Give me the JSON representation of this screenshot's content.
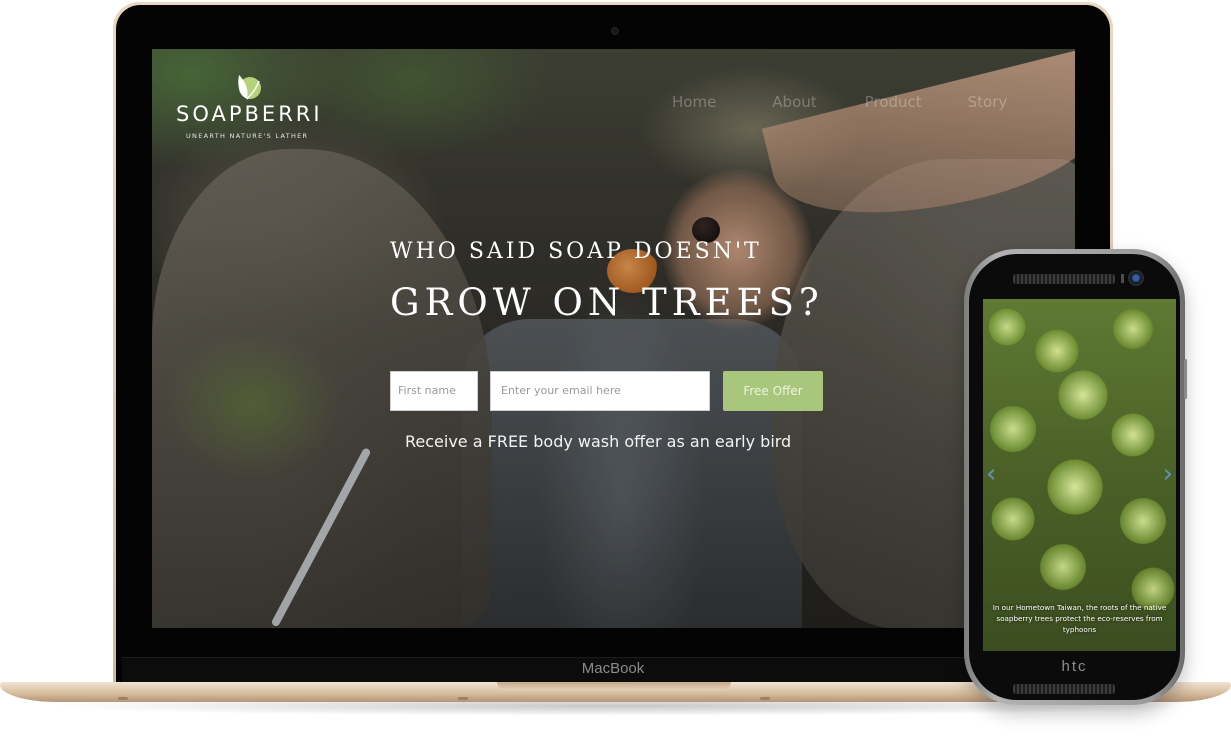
{
  "laptop": {
    "brand_label": "MacBook"
  },
  "site": {
    "logo": {
      "name": "SOAPBERRI",
      "tagline": "UNEARTH NATURE'S LATHER",
      "leaf_colors": [
        "#ffffff",
        "#b7d37a"
      ]
    },
    "nav": [
      {
        "label": "Home"
      },
      {
        "label": "About"
      },
      {
        "label": "Product"
      },
      {
        "label": "Story"
      }
    ],
    "hero": {
      "subtitle": "WHO SAID SOAP DOESN'T",
      "title": "GROW ON TREES?"
    },
    "signup": {
      "first_name_placeholder": "First name",
      "email_placeholder": "Enter your email here",
      "button_label": "Free Offer",
      "button_color": "#a8c67c",
      "note": "Receive a FREE body wash offer as an early bird"
    }
  },
  "phone": {
    "brand_label": "htc",
    "slider": {
      "prev_icon": "chevron-left-icon",
      "next_icon": "chevron-right-icon",
      "caption": "In our Hometown Taiwan, the roots of the native soapberry trees protect the eco-reserves from typhoons"
    }
  }
}
